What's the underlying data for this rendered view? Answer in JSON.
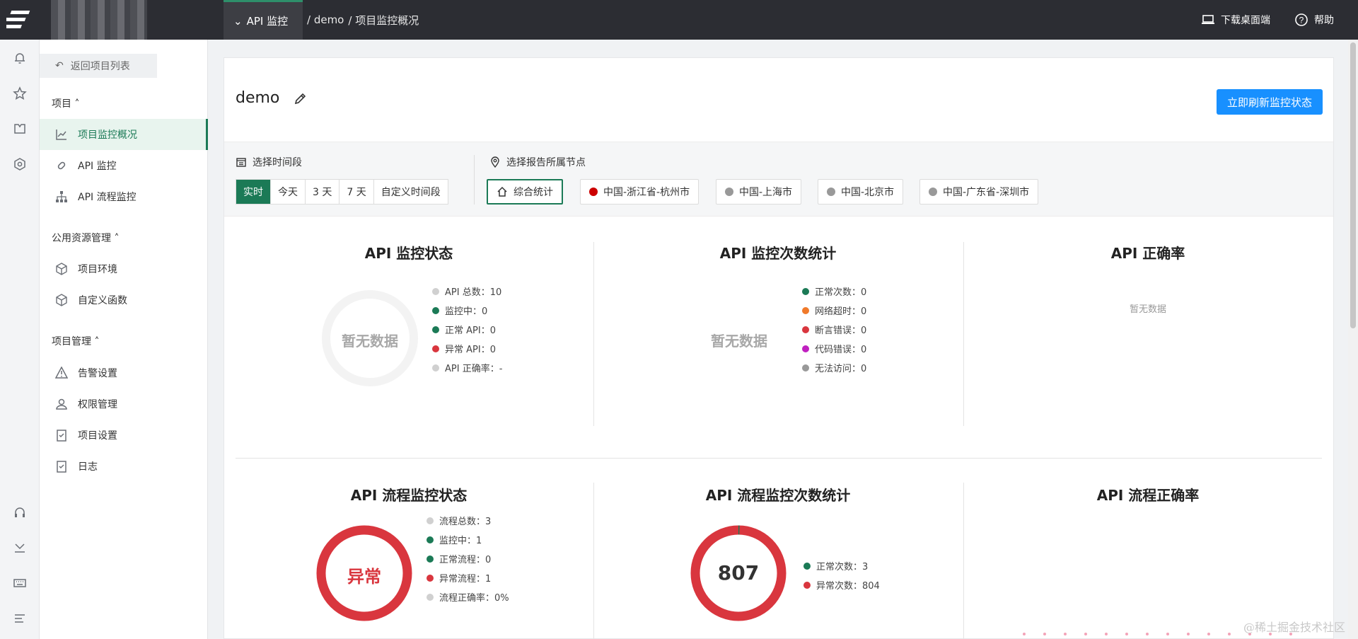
{
  "topbar": {
    "project_tab": "API 监控",
    "breadcrumb": [
      "/ demo",
      "/ 项目监控概况"
    ],
    "download": "下载桌面端",
    "help": "帮助"
  },
  "sidebar": {
    "back": "返回项目列表",
    "sections": [
      {
        "title": "项目 ˄",
        "items": [
          "项目监控概况",
          "API 监控",
          "API 流程监控"
        ]
      },
      {
        "title": "公用资源管理 ˄",
        "items": [
          "项目环境",
          "自定义函数"
        ]
      },
      {
        "title": "项目管理 ˄",
        "items": [
          "告警设置",
          "权限管理",
          "项目设置",
          "日志"
        ]
      }
    ]
  },
  "main": {
    "title": "demo",
    "refresh_btn": "立即刷新监控状态",
    "time_label": "选择时间段",
    "time_options": [
      "实时",
      "今天",
      "3 天",
      "7 天",
      "自定义时间段"
    ],
    "node_label": "选择报告所属节点",
    "nodes": [
      {
        "label": "综合统计",
        "color": null
      },
      {
        "label": "中国-浙江省-杭州市",
        "color": "#cc0000"
      },
      {
        "label": "中国-上海市",
        "color": "#999999"
      },
      {
        "label": "中国-北京市",
        "color": "#999999"
      },
      {
        "label": "中国-广东省-深圳市",
        "color": "#999999"
      }
    ],
    "panels": {
      "api_status": {
        "title": "API 监控状态",
        "center": "暂无数据",
        "legend": [
          {
            "text": "API 总数：10",
            "color": "#d0d0d0"
          },
          {
            "text": "监控中：0",
            "color": "#1b7a56"
          },
          {
            "text": "正常 API：0",
            "color": "#1b7a56"
          },
          {
            "text": "异常 API：0",
            "color": "#d9363e"
          },
          {
            "text": "API 正确率：-",
            "color": "#d0d0d0"
          }
        ]
      },
      "api_count": {
        "title": "API 监控次数统计",
        "center": "暂无数据",
        "legend": [
          {
            "text": "正常次数：0",
            "color": "#1b7a56"
          },
          {
            "text": "网络超时：0",
            "color": "#f07a2a"
          },
          {
            "text": "断言错误：0",
            "color": "#d9363e"
          },
          {
            "text": "代码错误：0",
            "color": "#c020c0"
          },
          {
            "text": "无法访问：0",
            "color": "#999999"
          }
        ]
      },
      "api_rate": {
        "title": "API 正确率",
        "empty": "暂无数据"
      },
      "flow_status": {
        "title": "API 流程监控状态",
        "center": "异常",
        "legend": [
          {
            "text": "流程总数：3",
            "color": "#d0d0d0"
          },
          {
            "text": "监控中：1",
            "color": "#1b7a56"
          },
          {
            "text": "正常流程：0",
            "color": "#1b7a56"
          },
          {
            "text": "异常流程：1",
            "color": "#d9363e"
          },
          {
            "text": "流程正确率：0%",
            "color": "#d0d0d0"
          }
        ]
      },
      "flow_count": {
        "title": "API 流程监控次数统计",
        "center": "807",
        "legend": [
          {
            "text": "正常次数：3",
            "color": "#1b7a56"
          },
          {
            "text": "异常次数：804",
            "color": "#d9363e"
          }
        ]
      },
      "flow_rate": {
        "title": "API 流程正确率"
      }
    }
  },
  "watermark": "@稀土掘金技术社区"
}
